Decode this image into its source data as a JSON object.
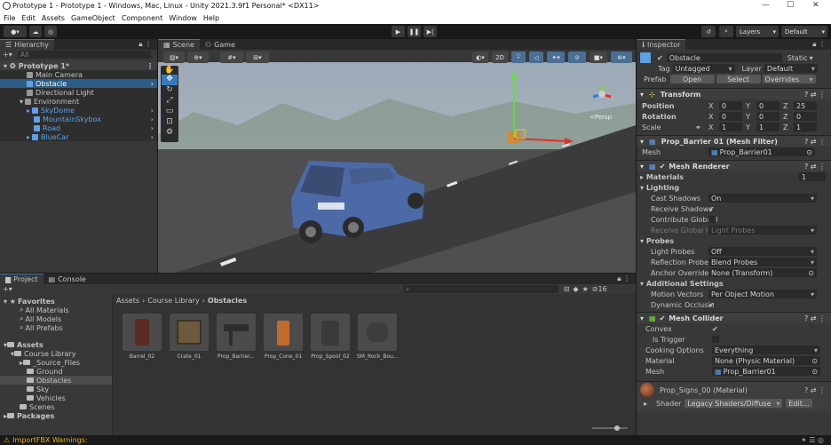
{
  "window": {
    "title": "Prototype 1 - Prototype 1 - Windows, Mac, Linux - Unity 2021.3.9f1 Personal* <DX11>"
  },
  "menu": [
    "File",
    "Edit",
    "Assets",
    "GameObject",
    "Component",
    "Window",
    "Help"
  ],
  "toolbar": {
    "layers": "Layers",
    "layout": "Default"
  },
  "hierarchy": {
    "tab": "Hierarchy",
    "search_placeholder": "All",
    "items": [
      {
        "label": "Prototype 1*"
      },
      {
        "label": "Main Camera"
      },
      {
        "label": "Obstacle"
      },
      {
        "label": "Directional Light"
      },
      {
        "label": "Environment"
      },
      {
        "label": "SkyDome"
      },
      {
        "label": "MountainSkybox"
      },
      {
        "label": "Road"
      },
      {
        "label": "BlueCar"
      }
    ]
  },
  "scene": {
    "tabs": [
      "Scene",
      "Game"
    ],
    "mode_2d": "2D",
    "persp_label": "<Persp"
  },
  "project": {
    "tabs": [
      "Project",
      "Console"
    ],
    "favorites": {
      "label": "Favorites",
      "items": [
        "All Materials",
        "All Models",
        "All Prefabs"
      ]
    },
    "assets": {
      "label": "Assets",
      "items": [
        "Course Library",
        "_Source_Files",
        "Ground",
        "Obstacles",
        "Sky",
        "Vehicles",
        "Scenes"
      ]
    },
    "packages": "Packages",
    "breadcrumb": [
      "Assets",
      "Course Library",
      "Obstacles"
    ],
    "hidden_count": "16",
    "files": [
      "Barrel_02",
      "Crate_01",
      "Prop_Barrier...",
      "Prop_Cone_01",
      "Prop_Spool_02",
      "SM_Rock_Bou..."
    ]
  },
  "inspector": {
    "tab": "Inspector",
    "object_name": "Obstacle",
    "static_label": "Static",
    "tag_label": "Tag",
    "tag_value": "Untagged",
    "layer_label": "Layer",
    "layer_value": "Default",
    "prefab_label": "Prefab",
    "prefab_open": "Open",
    "prefab_select": "Select",
    "prefab_overrides": "Overrides",
    "transform": {
      "title": "Transform",
      "position_label": "Position",
      "position": [
        "0",
        "0",
        "25"
      ],
      "rotation_label": "Rotation",
      "rotation": [
        "0",
        "0",
        "0"
      ],
      "scale_label": "Scale",
      "scale": [
        "1",
        "1",
        "1"
      ]
    },
    "mesh_filter": {
      "title": "Prop_Barrier 01 (Mesh Filter)",
      "mesh_label": "Mesh",
      "mesh_value": "Prop_Barrier01"
    },
    "mesh_renderer": {
      "title": "Mesh Renderer",
      "materials_label": "Materials",
      "materials_count": "1",
      "lighting_label": "Lighting",
      "cast_shadows_label": "Cast Shadows",
      "cast_shadows_value": "On",
      "receive_shadows_label": "Receive Shadows",
      "contribute_gi_label": "Contribute Global I",
      "receive_gi_label": "Receive Global Illu",
      "receive_gi_value": "Light Probes",
      "probes_label": "Probes",
      "light_probes_label": "Light Probes",
      "light_probes_value": "Off",
      "reflection_probes_label": "Reflection Probes",
      "reflection_probes_value": "Blend Probes",
      "anchor_override_label": "Anchor Override",
      "anchor_override_value": "None (Transform)",
      "additional_label": "Additional Settings",
      "motion_vectors_label": "Motion Vectors",
      "motion_vectors_value": "Per Object Motion",
      "dynamic_occlusion_label": "Dynamic Occlusio"
    },
    "mesh_collider": {
      "title": "Mesh Collider",
      "convex_label": "Convex",
      "is_trigger_label": "Is Trigger",
      "cooking_label": "Cooking Options",
      "cooking_value": "Everything",
      "material_label": "Material",
      "material_value": "None (Physic Material)",
      "mesh_label": "Mesh",
      "mesh_value": "Prop_Barrier01"
    },
    "material": {
      "title": "Prop_Signs_00 (Material)",
      "shader_label": "Shader",
      "shader_value": "Legacy Shaders/Diffuse",
      "edit_label": "Edit..."
    }
  },
  "status": {
    "warning": "ImportFBX Warnings:"
  },
  "colors": {
    "accent": "#3a79bb",
    "selection": "#2c5d87",
    "blue_text": "#5ea0e6",
    "warning": "#f0b400"
  }
}
